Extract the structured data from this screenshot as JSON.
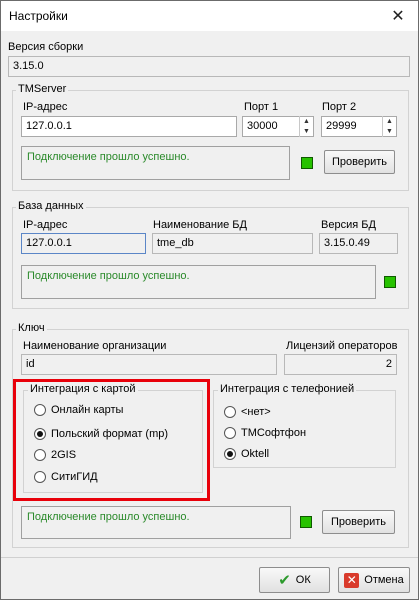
{
  "window": {
    "title": "Настройки",
    "close_glyph": "✕"
  },
  "build": {
    "label": "Версия сборки",
    "value": "3.15.0"
  },
  "tmserver": {
    "title": "TMServer",
    "ip_label": "IP-адрес",
    "ip_value": "127.0.0.1",
    "port1_label": "Порт 1",
    "port1_value": "30000",
    "port2_label": "Порт 2",
    "port2_value": "29999",
    "status_text": "Подключение прошло успешно.",
    "check_button": "Проверить"
  },
  "database": {
    "title": "База данных",
    "ip_label": "IP-адрес",
    "ip_value": "127.0.0.1",
    "dbname_label": "Наименование БД",
    "dbname_value": "tme_db",
    "version_label": "Версия БД",
    "version_value": "3.15.0.49",
    "status_text": "Подключение прошло успешно."
  },
  "key": {
    "title": "Ключ",
    "org_label": "Наименование организации",
    "org_value": "id",
    "licenses_label": "Лицензий операторов",
    "licenses_value": "2"
  },
  "map_integration": {
    "title": "Интеграция с картой",
    "options": [
      "Онлайн карты",
      "Польский формат (mp)",
      "2GIS",
      "СитиГИД"
    ],
    "selected_index": 1
  },
  "phone_integration": {
    "title": "Интеграция с телефонией",
    "options": [
      "<нет>",
      "ТМСофтфон",
      "Oktell"
    ],
    "selected_index": 2
  },
  "bottom": {
    "status_text": "Подключение прошло успешно.",
    "check_button": "Проверить"
  },
  "footer": {
    "ok_label": "ОК",
    "cancel_label": "Отмена"
  },
  "colors": {
    "success": "#27c200",
    "highlight": "#e8000a"
  }
}
